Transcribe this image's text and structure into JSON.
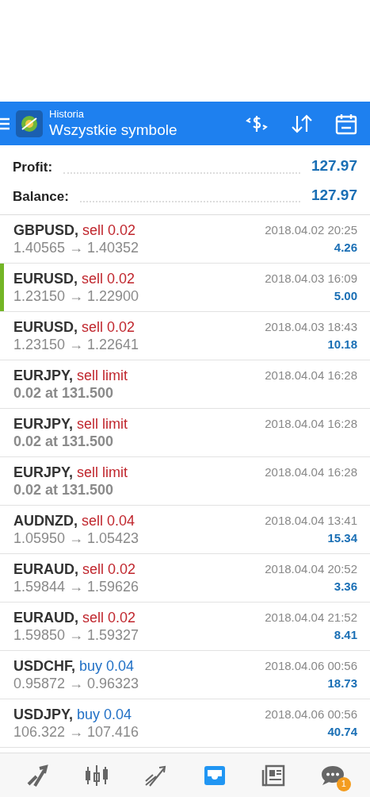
{
  "header": {
    "subtitle": "Historia",
    "title": "Wszystkie symbole"
  },
  "summary": [
    {
      "label": "Profit:",
      "value": "127.97"
    },
    {
      "label": "Balance:",
      "value": "127.97"
    }
  ],
  "deals": [
    {
      "kind": "trade",
      "symbol": "GBPUSD,",
      "side": "sell",
      "amount": "0.02",
      "detail": "1.40565 → 1.40352",
      "time": "2018.04.02 20:25",
      "profit": "4.26",
      "selected": false
    },
    {
      "kind": "trade",
      "symbol": "EURUSD,",
      "side": "sell",
      "amount": "0.02",
      "detail": "1.23150 → 1.22900",
      "time": "2018.04.03 16:09",
      "profit": "5.00",
      "selected": true
    },
    {
      "kind": "trade",
      "symbol": "EURUSD,",
      "side": "sell",
      "amount": "0.02",
      "detail": "1.23150 → 1.22641",
      "time": "2018.04.03 18:43",
      "profit": "10.18",
      "selected": false
    },
    {
      "kind": "order",
      "symbol": "EURJPY,",
      "side": "sell",
      "amount": "limit",
      "detail": "0.02 at 131.500",
      "time": "2018.04.04 16:28",
      "selected": false
    },
    {
      "kind": "order",
      "symbol": "EURJPY,",
      "side": "sell",
      "amount": "limit",
      "detail": "0.02 at 131.500",
      "time": "2018.04.04 16:28",
      "selected": false
    },
    {
      "kind": "order",
      "symbol": "EURJPY,",
      "side": "sell",
      "amount": "limit",
      "detail": "0.02 at 131.500",
      "time": "2018.04.04 16:28",
      "selected": false
    },
    {
      "kind": "trade",
      "symbol": "AUDNZD,",
      "side": "sell",
      "amount": "0.04",
      "detail": "1.05950 → 1.05423",
      "time": "2018.04.04 13:41",
      "profit": "15.34",
      "selected": false
    },
    {
      "kind": "trade",
      "symbol": "EURAUD,",
      "side": "sell",
      "amount": "0.02",
      "detail": "1.59844 → 1.59626",
      "time": "2018.04.04 20:52",
      "profit": "3.36",
      "selected": false
    },
    {
      "kind": "trade",
      "symbol": "EURAUD,",
      "side": "sell",
      "amount": "0.02",
      "detail": "1.59850 → 1.59327",
      "time": "2018.04.04 21:52",
      "profit": "8.41",
      "selected": false
    },
    {
      "kind": "trade",
      "symbol": "USDCHF,",
      "side": "buy",
      "amount": "0.04",
      "detail": "0.95872 → 0.96323",
      "time": "2018.04.06 00:56",
      "profit": "18.73",
      "selected": false
    },
    {
      "kind": "trade",
      "symbol": "USDJPY,",
      "side": "buy",
      "amount": "0.04",
      "detail": "106.322 → 107.416",
      "time": "2018.04.06 00:56",
      "profit": "40.74",
      "selected": false
    }
  ],
  "nav": [
    {
      "kind": "quotes",
      "selected": false
    },
    {
      "kind": "chart",
      "selected": false
    },
    {
      "kind": "trade",
      "selected": false
    },
    {
      "kind": "history",
      "selected": true
    },
    {
      "kind": "news",
      "selected": false
    },
    {
      "kind": "chat",
      "selected": false,
      "badge": "1"
    }
  ]
}
